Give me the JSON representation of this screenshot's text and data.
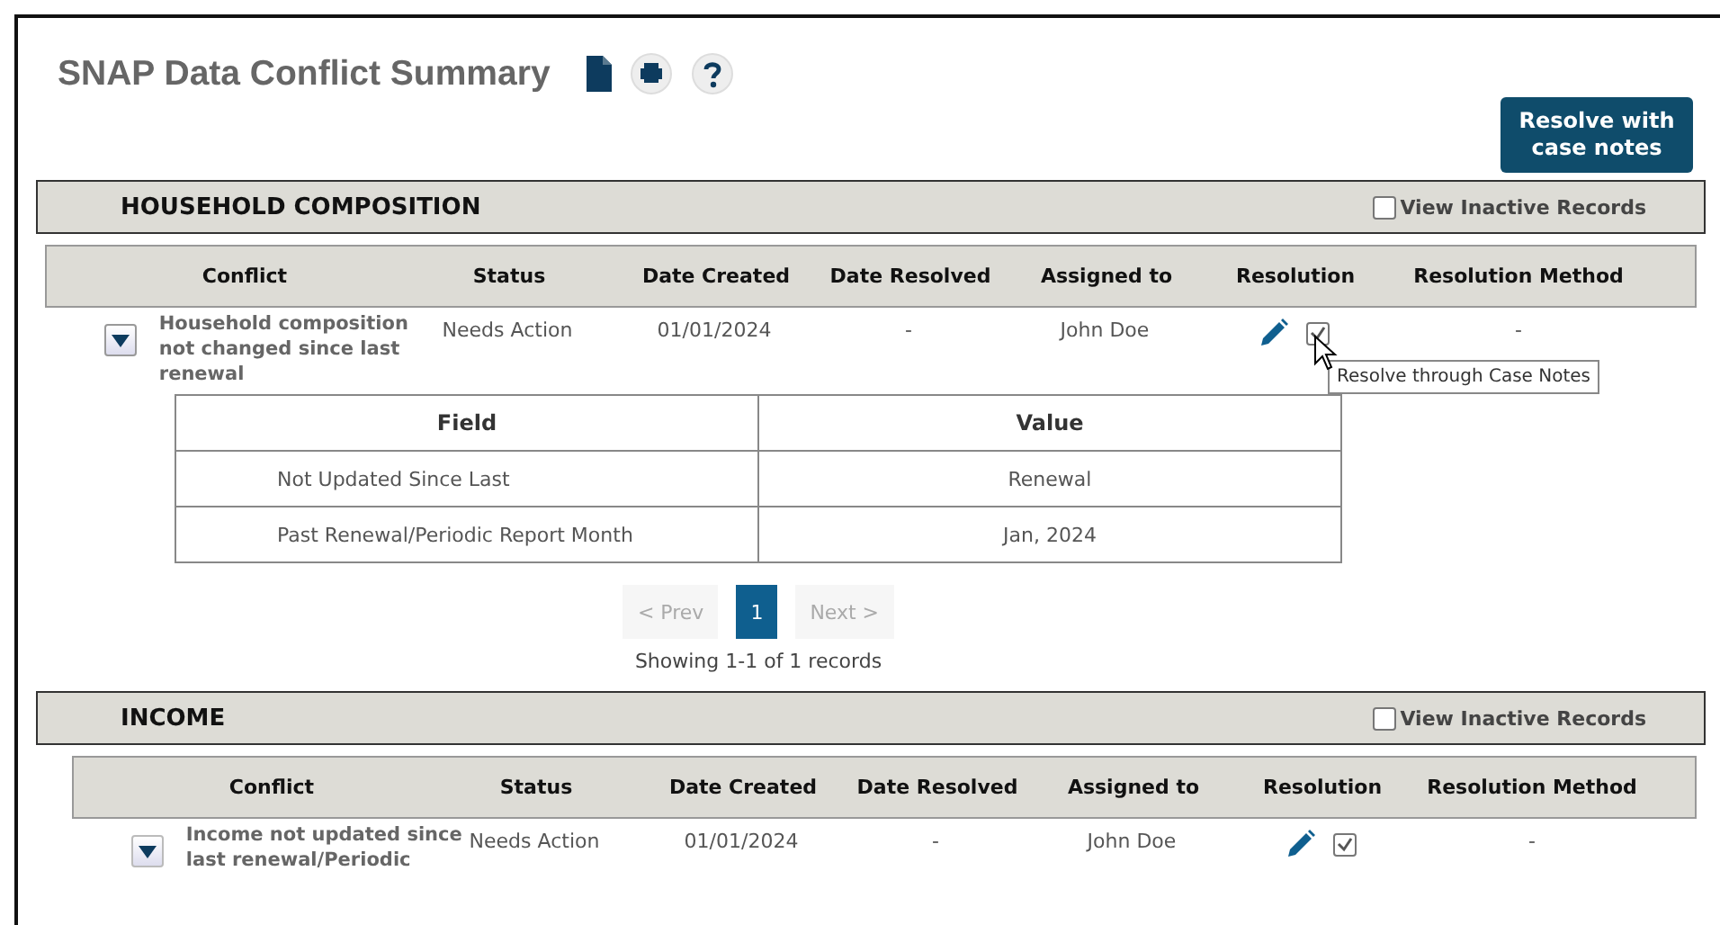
{
  "page": {
    "title": "SNAP Data Conflict Summary",
    "action_button": "Resolve with case notes"
  },
  "sections": [
    {
      "title": "HOUSEHOLD COMPOSITION",
      "inactive_toggle": {
        "label": "View Inactive Records",
        "checked": false
      },
      "columns": [
        "Conflict",
        "Status",
        "Date Created",
        "Date Resolved",
        "Assigned to",
        "Resolution",
        "Resolution Method"
      ],
      "rows": [
        {
          "conflict": "Household composition not changed since last renewal",
          "status": "Needs Action",
          "date_created": "01/01/2024",
          "date_resolved": "-",
          "assigned_to": "John Doe",
          "resolved_through_notes": true,
          "resolution_method": "-",
          "expanded": true,
          "tooltip": "Resolve through Case Notes",
          "details": {
            "columns": [
              "Field",
              "Value"
            ],
            "rows": [
              [
                "Not Updated Since Last",
                "Renewal"
              ],
              [
                "Past Renewal/Periodic Report Month",
                "Jan, 2024"
              ]
            ]
          },
          "pager": {
            "prev": {
              "label": "< Prev",
              "disabled": true
            },
            "pages": [
              {
                "label": "1",
                "selected": true
              }
            ],
            "next": {
              "label": "Next >",
              "disabled": true
            },
            "summary": "Showing 1-1 of 1 records"
          }
        }
      ]
    },
    {
      "title": "INCOME",
      "inactive_toggle": {
        "label": "View Inactive Records",
        "checked": false
      },
      "columns": [
        "Conflict",
        "Status",
        "Date Created",
        "Date Resolved",
        "Assigned to",
        "Resolution",
        "Resolution Method"
      ],
      "rows": [
        {
          "conflict": "Income not updated since last renewal/Periodic",
          "status": "Needs Action",
          "date_created": "01/01/2024",
          "date_resolved": "-",
          "assigned_to": "John Doe",
          "resolved_through_notes": true,
          "resolution_method": "-",
          "expanded": false
        }
      ]
    }
  ]
}
